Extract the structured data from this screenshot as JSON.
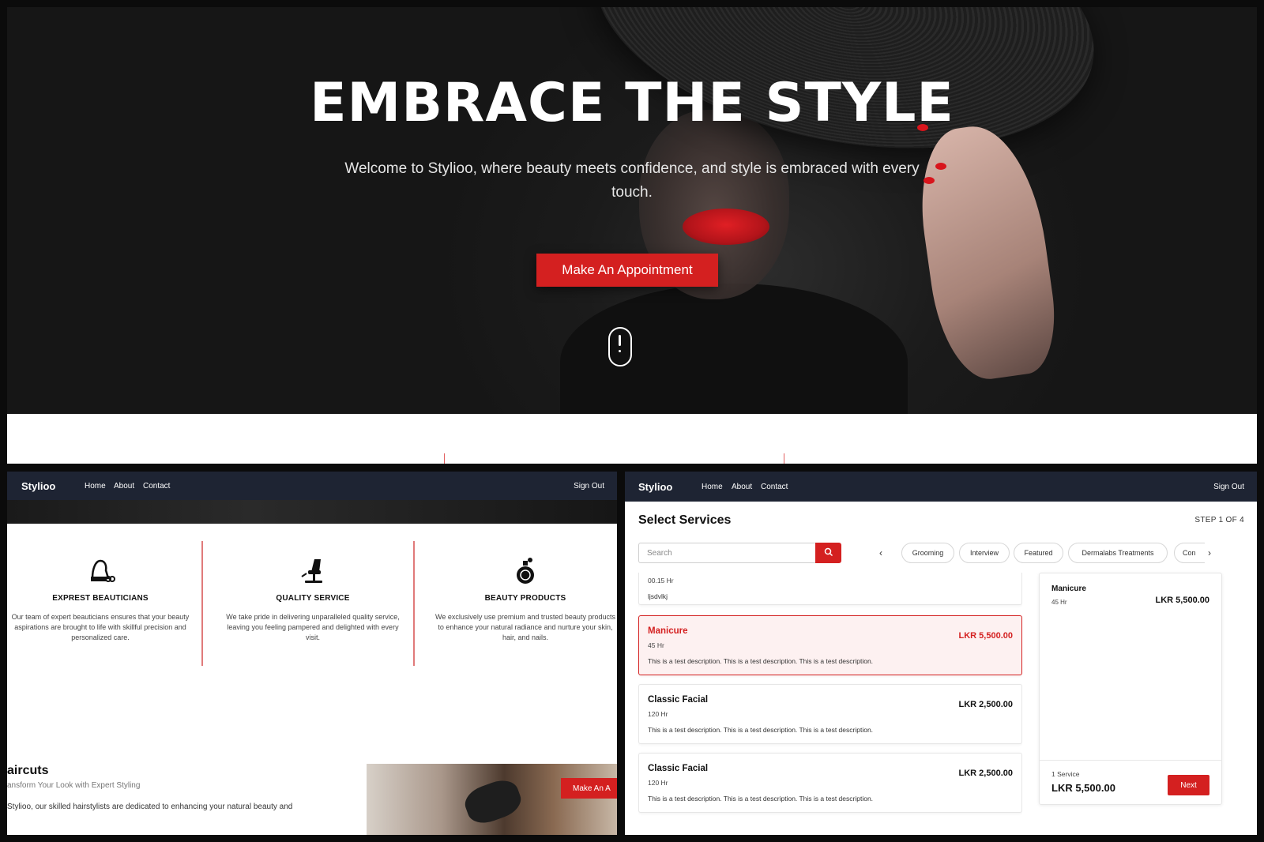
{
  "hero": {
    "title": "EMBRACE THE STYLE",
    "subtitle": "Welcome to Stylioo, where beauty meets confidence, and style is embraced with every touch.",
    "cta_label": "Make An Appointment"
  },
  "nav": {
    "brand": "Stylioo",
    "links": [
      "Home",
      "About",
      "Contact"
    ],
    "sign_out": "Sign Out"
  },
  "features": {
    "items": [
      {
        "title": "EXPREST BEAUTICIANS",
        "icon": "beautician-icon",
        "description": "Our team of expert beauticians ensures that your beauty aspirations are brought to life with skillful precision and personalized care."
      },
      {
        "title": "QUALITY SERVICE",
        "icon": "salon-chair-icon",
        "description": "We take pride in delivering unparalleled quality service, leaving you feeling pampered and delighted with every visit."
      },
      {
        "title": "BEAUTY PRODUCTS",
        "icon": "perfume-bottle-icon",
        "description": "We exclusively use premium and trusted beauty products to enhance your natural radiance and nurture your skin, hair, and nails."
      }
    ],
    "haircuts": {
      "title": "aircuts",
      "subtitle": "ansform Your Look with Expert Styling",
      "body": "Stylioo, our skilled hairstylists are dedicated to enhancing your natural beauty and",
      "cta_label": "Make An A"
    }
  },
  "booking": {
    "title": "Select Services",
    "step": "STEP 1 OF 4",
    "search_placeholder": "Search",
    "categories": [
      "Grooming",
      "Interview",
      "Featured",
      "Dermalabs Treatments",
      "Con"
    ],
    "partial_service": {
      "duration": "00.15 Hr",
      "description": "ljsdvlkj"
    },
    "services": [
      {
        "name": "Manicure",
        "duration": "45 Hr",
        "price": "LKR 5,500.00",
        "description": "This is a test description. This is a test description. This is a test description.",
        "selected": true
      },
      {
        "name": "Classic Facial",
        "duration": "120 Hr",
        "price": "LKR 2,500.00",
        "description": "This is a test description. This is a test description. This is a test description.",
        "selected": false
      },
      {
        "name": "Classic Facial",
        "duration": "120 Hr",
        "price": "LKR 2,500.00",
        "description": "This is a test description. This is a test description. This is a test description.",
        "selected": false
      }
    ],
    "summary": {
      "item_name": "Manicure",
      "item_duration": "45 Hr",
      "item_price": "LKR 5,500.00",
      "count": "1 Service",
      "total": "LKR 5,500.00",
      "next_label": "Next"
    }
  },
  "colors": {
    "accent": "#d42020",
    "nav_bg": "#1e2433",
    "hero_bg": "#1b1b1b"
  }
}
